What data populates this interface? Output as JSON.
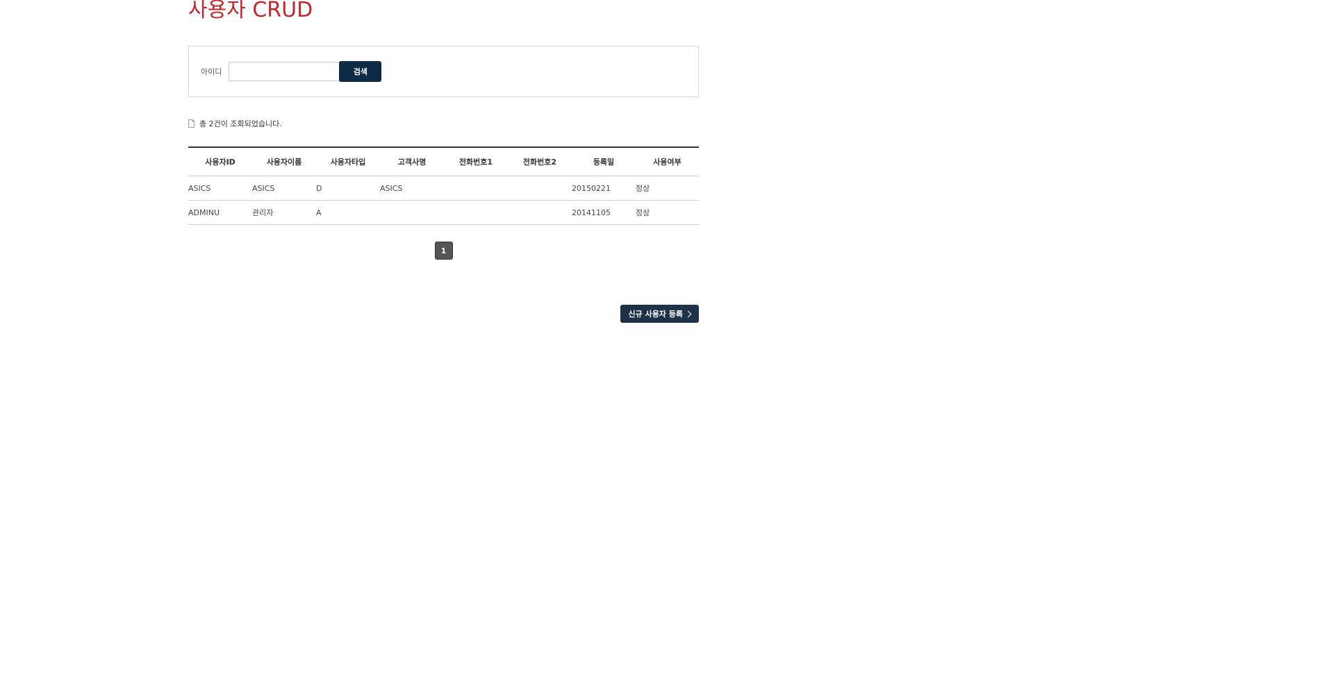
{
  "page": {
    "title": "사용자 CRUD"
  },
  "search": {
    "label": "아이디",
    "value": "",
    "placeholder": "",
    "button_label": "검색"
  },
  "summary": {
    "text": "총 2건이 조회되었습니다.",
    "icon": "document-icon"
  },
  "table": {
    "headers": [
      "사용자ID",
      "사용자이름",
      "사용자타입",
      "고객사명",
      "전화번호1",
      "전화번호2",
      "등록일",
      "사용여부"
    ],
    "rows": [
      [
        "ASICS",
        "ASICS",
        "D",
        "ASICS",
        "",
        "",
        "20150221",
        "정상"
      ],
      [
        "ADMINU",
        "관리자",
        "A",
        "",
        "",
        "",
        "20141105",
        "정상"
      ]
    ]
  },
  "pagination": {
    "pages": [
      "1"
    ],
    "current": "1"
  },
  "actions": {
    "register_label": "신규 사용자 등록",
    "register_icon": "chevron-right-icon"
  },
  "colors": {
    "title": "#c0282d",
    "search_button": "#0f2a45",
    "register_button": "#1f3149",
    "page_active": "#555555"
  }
}
